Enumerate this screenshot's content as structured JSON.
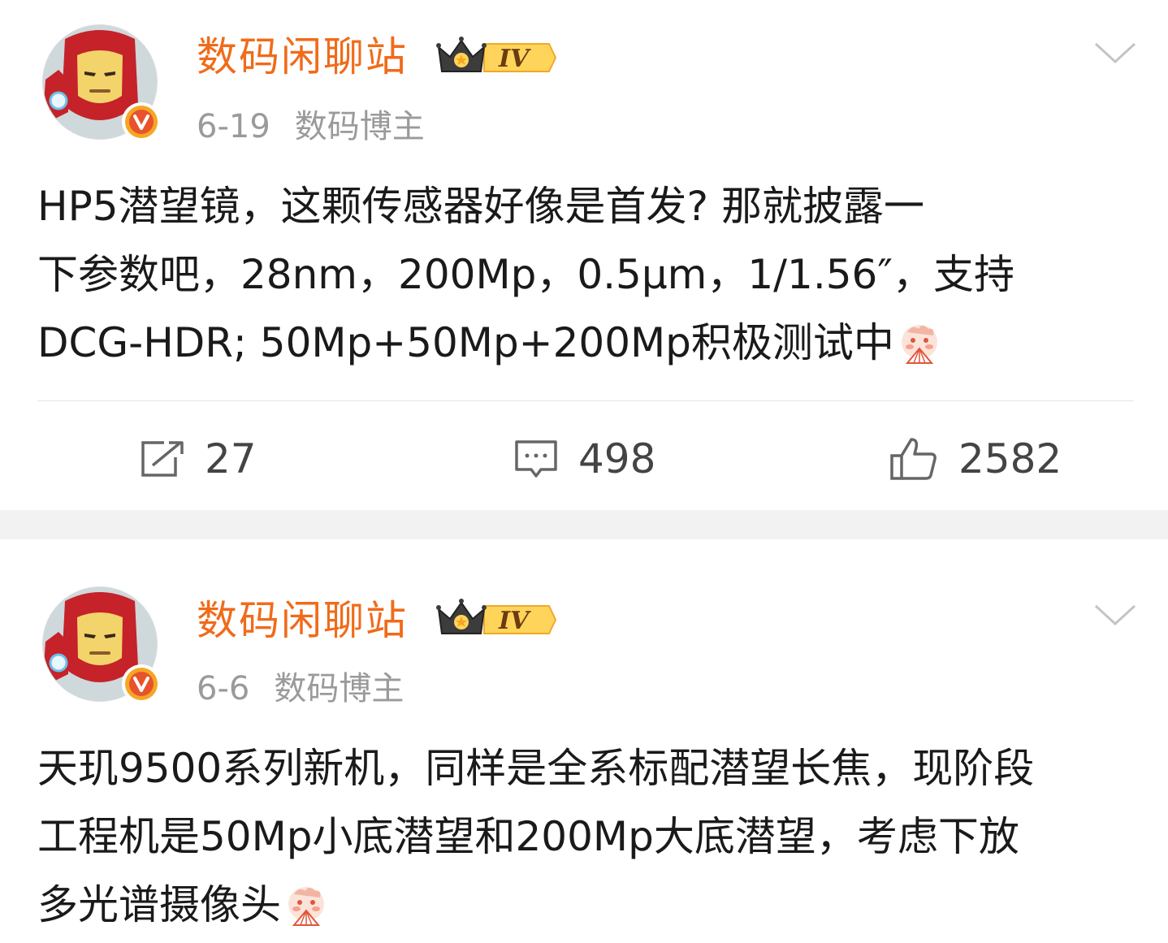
{
  "posts": [
    {
      "author": "数码闲聊站",
      "level": "IV",
      "date": "6-19",
      "tag": "数码博主",
      "content_lines": [
        "HP5潜望镜，这颗传感器好像是首发? 那就披露一",
        "下参数吧，28nm，200Mp，0.5μm，1/1.56″，支持",
        "DCG-HDR; 50Mp+50Mp+200Mp积极测试中"
      ],
      "emoji": "fan-face-emoji",
      "repost_count": "27",
      "comment_count": "498",
      "like_count": "2582"
    },
    {
      "author": "数码闲聊站",
      "level": "IV",
      "date": "6-6",
      "tag": "数码博主",
      "content_lines": [
        "天玑9500系列新机，同样是全系标配潜望长焦，现阶段",
        "工程机是50Mp小底潜望和200Mp大底潜望，考虑下放",
        "多光谱摄像头"
      ],
      "emoji": "fan-face-emoji"
    }
  ],
  "colors": {
    "username": "#f06b1a",
    "meta": "#9a9a9a",
    "text": "#1a1a1a",
    "verified_badge": "#f5a623",
    "separator": "#f2f2f2"
  },
  "icons": {
    "avatar": "iron-man-avatar",
    "verified": "verified-v-badge-icon",
    "menu": "chevron-down-icon",
    "repost": "repost-icon",
    "comment": "comment-icon",
    "like": "thumbs-up-icon"
  }
}
